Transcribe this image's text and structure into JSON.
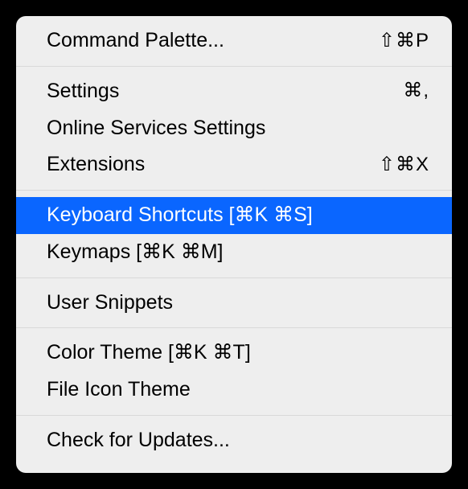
{
  "menu": {
    "groups": [
      [
        {
          "id": "command-palette",
          "label": "Command Palette...",
          "shortcut": "⇧⌘P",
          "selected": false
        }
      ],
      [
        {
          "id": "settings",
          "label": "Settings",
          "shortcut": "⌘,",
          "selected": false
        },
        {
          "id": "online-services-settings",
          "label": "Online Services Settings",
          "shortcut": "",
          "selected": false
        },
        {
          "id": "extensions",
          "label": "Extensions",
          "shortcut": "⇧⌘X",
          "selected": false
        }
      ],
      [
        {
          "id": "keyboard-shortcuts",
          "label": "Keyboard Shortcuts [⌘K ⌘S]",
          "shortcut": "",
          "selected": true
        },
        {
          "id": "keymaps",
          "label": "Keymaps [⌘K ⌘M]",
          "shortcut": "",
          "selected": false
        }
      ],
      [
        {
          "id": "user-snippets",
          "label": "User Snippets",
          "shortcut": "",
          "selected": false
        }
      ],
      [
        {
          "id": "color-theme",
          "label": "Color Theme [⌘K ⌘T]",
          "shortcut": "",
          "selected": false
        },
        {
          "id": "file-icon-theme",
          "label": "File Icon Theme",
          "shortcut": "",
          "selected": false
        }
      ],
      [
        {
          "id": "check-for-updates",
          "label": "Check for Updates...",
          "shortcut": "",
          "selected": false
        }
      ]
    ]
  }
}
